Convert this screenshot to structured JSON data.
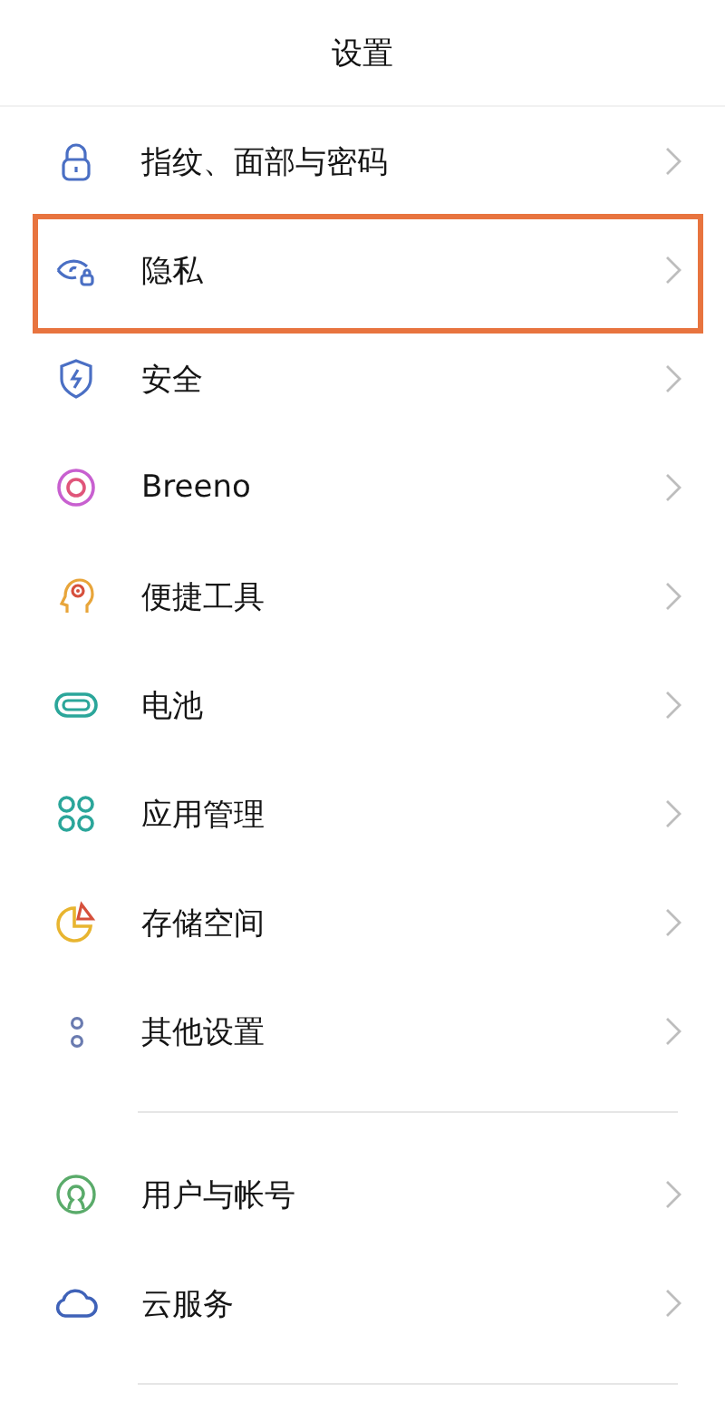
{
  "title": "设置",
  "groups": [
    {
      "items": [
        {
          "label": "指纹、面部与密码",
          "kind": "lock",
          "highlighted": false
        },
        {
          "label": "隐私",
          "kind": "eye",
          "highlighted": true
        },
        {
          "label": "安全",
          "kind": "shield",
          "highlighted": false
        },
        {
          "label": "Breeno",
          "kind": "ring",
          "highlighted": false
        },
        {
          "label": "便捷工具",
          "kind": "head",
          "highlighted": false
        },
        {
          "label": "电池",
          "kind": "battery",
          "highlighted": false
        },
        {
          "label": "应用管理",
          "kind": "apps",
          "highlighted": false
        },
        {
          "label": "存储空间",
          "kind": "pie",
          "highlighted": false
        },
        {
          "label": "其他设置",
          "kind": "dots",
          "highlighted": false
        }
      ]
    },
    {
      "items": [
        {
          "label": "用户与帐号",
          "kind": "user",
          "highlighted": false
        },
        {
          "label": "云服务",
          "kind": "cloud",
          "highlighted": false
        }
      ]
    }
  ]
}
